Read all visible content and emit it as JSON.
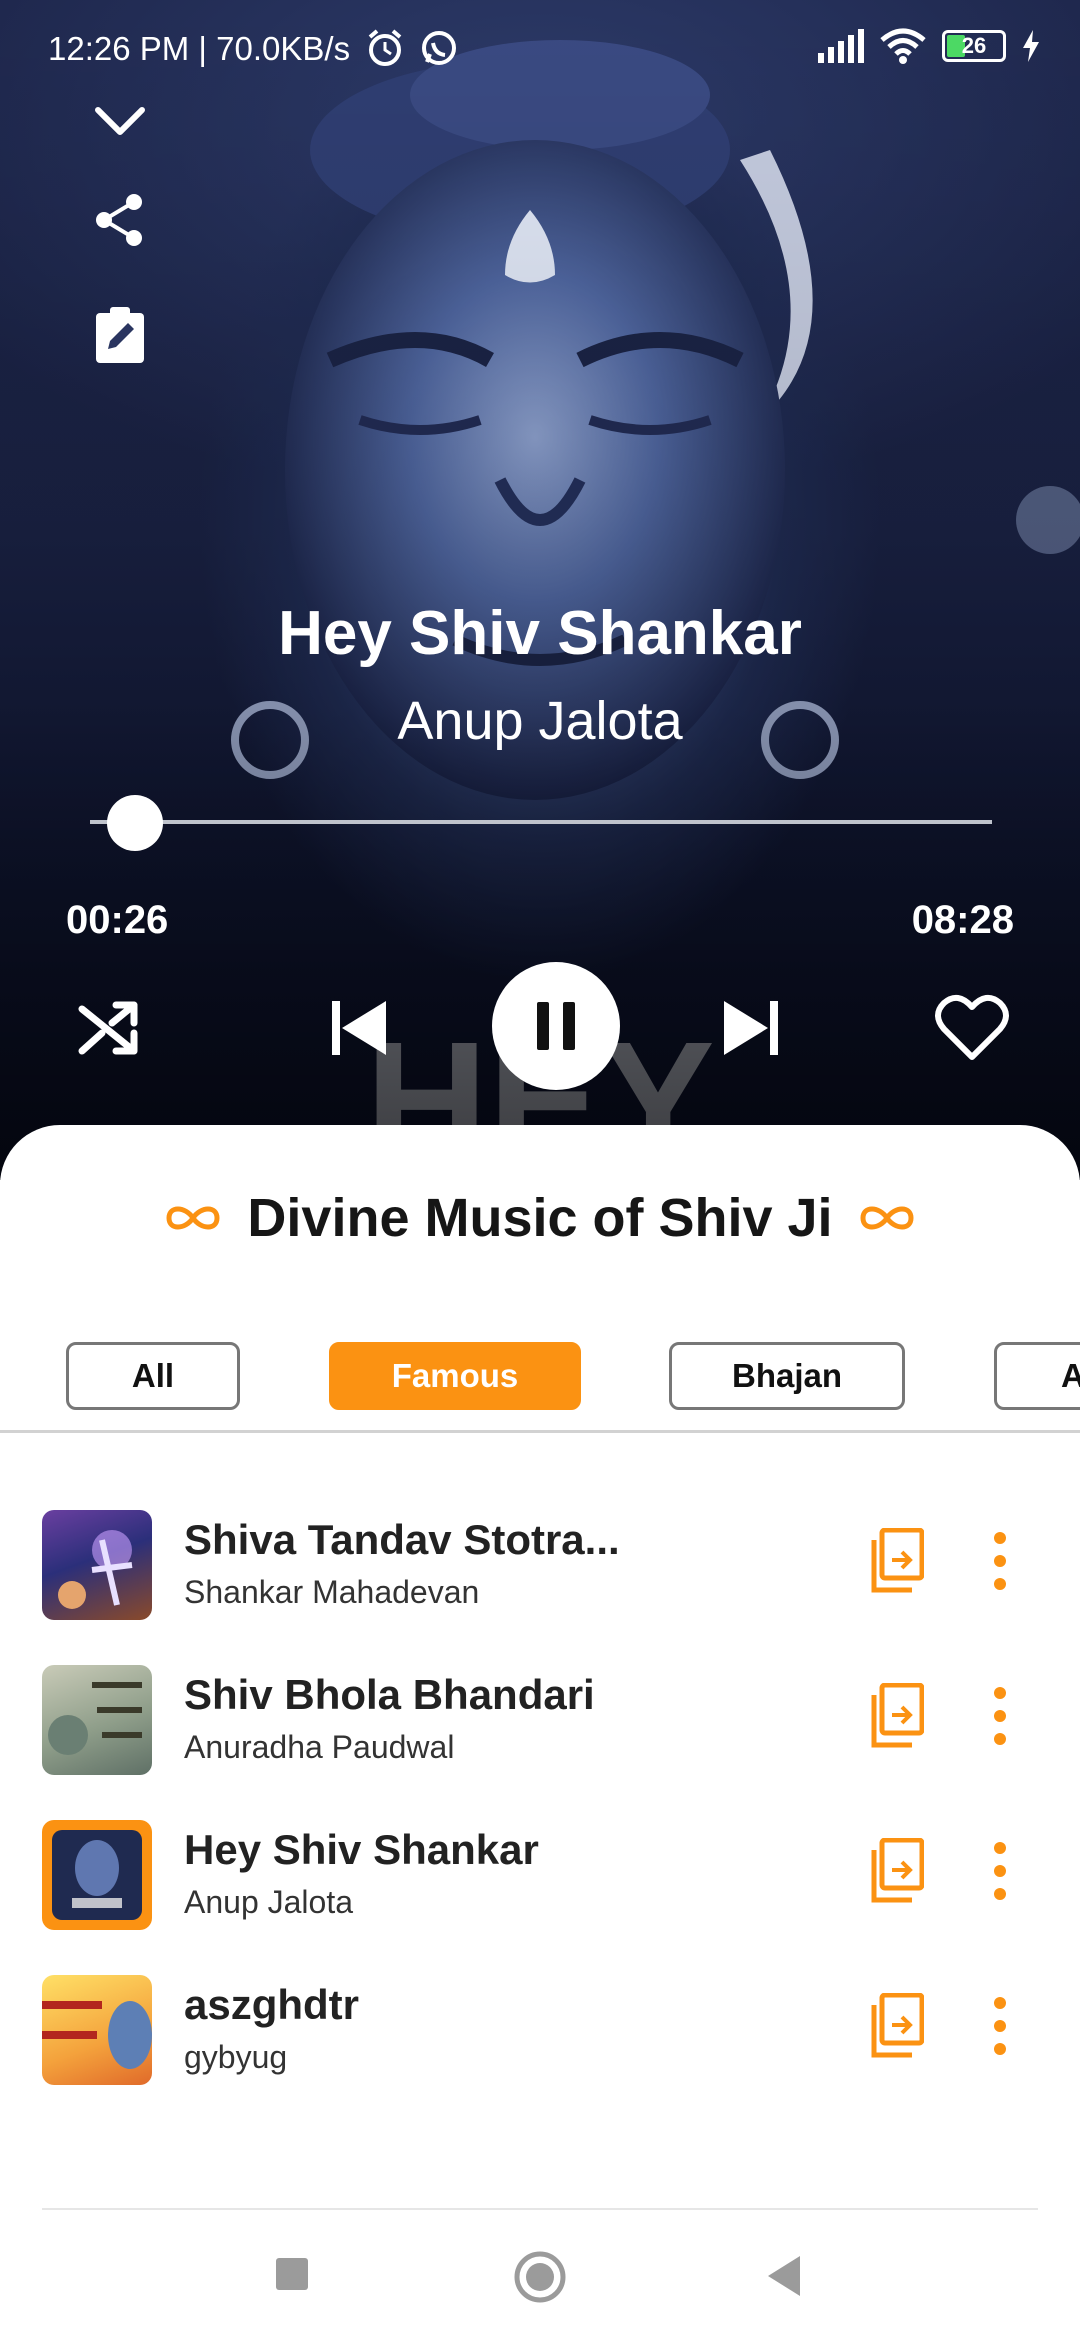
{
  "status": {
    "time": "12:26 PM | 70.0KB/s",
    "battery": "26"
  },
  "player": {
    "title": "Hey Shiv Shankar",
    "artist": "Anup Jalota",
    "current_time": "00:26",
    "total_time": "08:28",
    "progress_fraction": 0.05,
    "accent_color": "#fb9212",
    "icons": [
      "collapse-chevron-icon",
      "share-icon",
      "edit-clipboard-icon",
      "shuffle-icon",
      "previous-icon",
      "pause-icon",
      "next-icon",
      "heart-icon"
    ]
  },
  "playlist": {
    "title": "Divine Music of Shiv Ji",
    "tabs": [
      {
        "label": "All",
        "active": false
      },
      {
        "label": "Famous",
        "active": true
      },
      {
        "label": "Bhajan",
        "active": false
      },
      {
        "label": "A",
        "active": false
      }
    ],
    "items": [
      {
        "title": "Shiva Tandav Stotra...",
        "artist": "Shankar Mahadevan"
      },
      {
        "title": "Shiv Bhola Bhandari",
        "artist": "Anuradha Paudwal"
      },
      {
        "title": "Hey Shiv Shankar",
        "artist": "Anup Jalota"
      },
      {
        "title": "aszghdtr",
        "artist": "gybyug"
      }
    ]
  }
}
